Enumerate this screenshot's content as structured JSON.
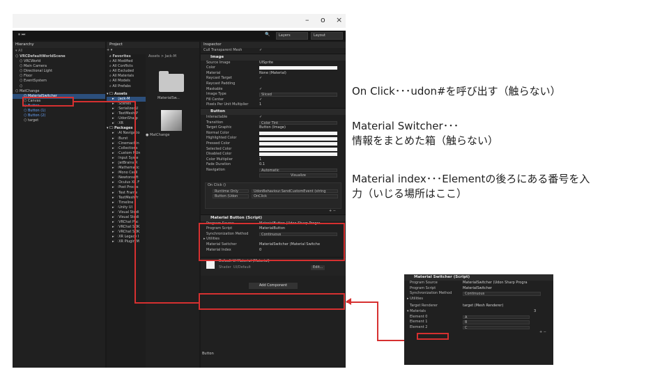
{
  "window": {
    "controls": [
      "–",
      "o",
      "×"
    ]
  },
  "toolbar": {
    "play_icons": "⏸ ⏭",
    "layers_label": "Layers",
    "layout_label": "Layout"
  },
  "hierarchy": {
    "tab": "Hierarchy",
    "search_placeholder": "All",
    "items": [
      {
        "label": "VRCDefaultWorldScene",
        "indent": 0,
        "style": "bold"
      },
      {
        "label": "VRCWorld",
        "indent": 1
      },
      {
        "label": "Main Camera",
        "indent": 1
      },
      {
        "label": "Directional Light",
        "indent": 1
      },
      {
        "label": "Floor",
        "indent": 1
      },
      {
        "label": "EventSystem",
        "indent": 1
      },
      {
        "label": " ",
        "indent": 1
      },
      {
        "label": "MatChange",
        "indent": 0
      },
      {
        "label": "MaterialSwitcher",
        "indent": 2,
        "style": "hi"
      },
      {
        "label": "Canvas",
        "indent": 2
      },
      {
        "label": "Button",
        "indent": 2,
        "style": "blue"
      },
      {
        "label": "Button (1)",
        "indent": 2,
        "style": "blue"
      },
      {
        "label": "Button (2)",
        "indent": 2,
        "style": "blue"
      },
      {
        "label": "target",
        "indent": 2
      }
    ]
  },
  "project": {
    "tab": "Project",
    "favorites": [
      "Favorites",
      "All Modified",
      "All Conflicts",
      "All Excluded",
      "All Materials",
      "All Models",
      "All Prefabs"
    ],
    "assets_header": "Assets",
    "assets": [
      "Jack-M",
      "Scenes",
      "SerializedU",
      "TextMesh P",
      "UdonSharp",
      "XR"
    ],
    "packages_header": "Packages",
    "packages": [
      "AI Navigatio",
      "Burst",
      "Cinemachin",
      "Collections",
      "Custom NUn",
      "Input Syste",
      "JetBrains R",
      "Mathematic",
      "Mono Cecil",
      "Newtonsoft",
      "Oculus XR F",
      "Post Proces",
      "Test Frame",
      "TextMeshPr",
      "Timeline",
      "Unity UI",
      "Visual Studi",
      "Visual Studi",
      "VRChat Pac",
      "VRChat SDK",
      "VRChat SDK",
      "XR Legacy I",
      "XR Plugin M"
    ],
    "breadcrumb": "Assets > Jack-M",
    "grid_items": [
      "MaterialSw...",
      "MatChange"
    ]
  },
  "inspector": {
    "tab": "Inspector",
    "cull_label": "Cull Transparent Mesh",
    "image": {
      "header": "Image",
      "rows": [
        {
          "label": "Source Image",
          "value": "UISprite"
        },
        {
          "label": "Color",
          "value": ""
        },
        {
          "label": "Material",
          "value": "None (Material)"
        },
        {
          "label": "Raycast Target",
          "value": "✓"
        },
        {
          "label": "Raycast Padding",
          "value": ""
        },
        {
          "label": "Maskable",
          "value": "✓"
        },
        {
          "label": "Image Type",
          "value": "Sliced"
        },
        {
          "label": "Fill Center",
          "value": "✓"
        },
        {
          "label": "Pixels Per Unit Multiplier",
          "value": "1"
        }
      ]
    },
    "button": {
      "header": "Button",
      "rows": [
        {
          "label": "Interactable",
          "value": "✓"
        },
        {
          "label": "Transition",
          "value": "Color Tint"
        },
        {
          "label": "Target Graphic",
          "value": "Button (Image)"
        },
        {
          "label": "Normal Color",
          "value": ""
        },
        {
          "label": "Highlighted Color",
          "value": ""
        },
        {
          "label": "Pressed Color",
          "value": ""
        },
        {
          "label": "Selected Color",
          "value": ""
        },
        {
          "label": "Disabled Color",
          "value": ""
        },
        {
          "label": "Color Multiplier",
          "value": "1"
        },
        {
          "label": "Fade Duration",
          "value": "0.1"
        },
        {
          "label": "Navigation",
          "value": "Automatic"
        }
      ],
      "visualize": "Visualize"
    },
    "onclick": {
      "header": "On Click ()",
      "mode": "Runtime Only",
      "function": "UdonBehaviour.SendCustomEvent (string",
      "target": "Button (Udon",
      "arg": "OnClick"
    },
    "matbutton": {
      "header": "Material Button (Script)",
      "rows": [
        {
          "label": "Program Source",
          "value": "MaterialButton (Udon Sharp Progra"
        },
        {
          "label": "Program Script",
          "value": "MaterialButton"
        },
        {
          "label": "Synchronization Method",
          "value": "Continuous"
        }
      ],
      "utilities": "Utilities",
      "switcher_label": "Material Switcher",
      "switcher_value": "MaterialSwitcher (Material Switche",
      "index_label": "Material Index",
      "index_value": "0"
    },
    "material": {
      "name": "Default UI Material (Material)",
      "shader_label": "Shader",
      "shader_value": "UI/Default",
      "edit": "Edit..."
    },
    "add_component": "Add Component",
    "footer": "Button"
  },
  "notes": [
    "On Click･･･udon#を呼び出す（触らない）",
    "Material Switcher･･･",
    "情報をまとめた箱（触らない）",
    "Material index･･･Elementの後ろにある番号を入",
    "力（いじる場所はここ）"
  ],
  "switcher_panel": {
    "header": "Material Switcher (Script)",
    "rows": [
      {
        "label": "Program Source",
        "value": "MaterialSwitcher (Udon Sharp Progra"
      },
      {
        "label": "Program Script",
        "value": "MaterialSwitcher"
      },
      {
        "label": "Synchronization Method",
        "value": "Continuous"
      }
    ],
    "utilities": "Utilities",
    "target_label": "Target Renderer",
    "target_value": "target (Mesh Renderer)",
    "materials_label": "Materials",
    "materials_count": "3",
    "elements": [
      {
        "label": "Element 0",
        "value": "A"
      },
      {
        "label": "Element 1",
        "value": "B"
      },
      {
        "label": "Element 2",
        "value": "C"
      }
    ]
  }
}
